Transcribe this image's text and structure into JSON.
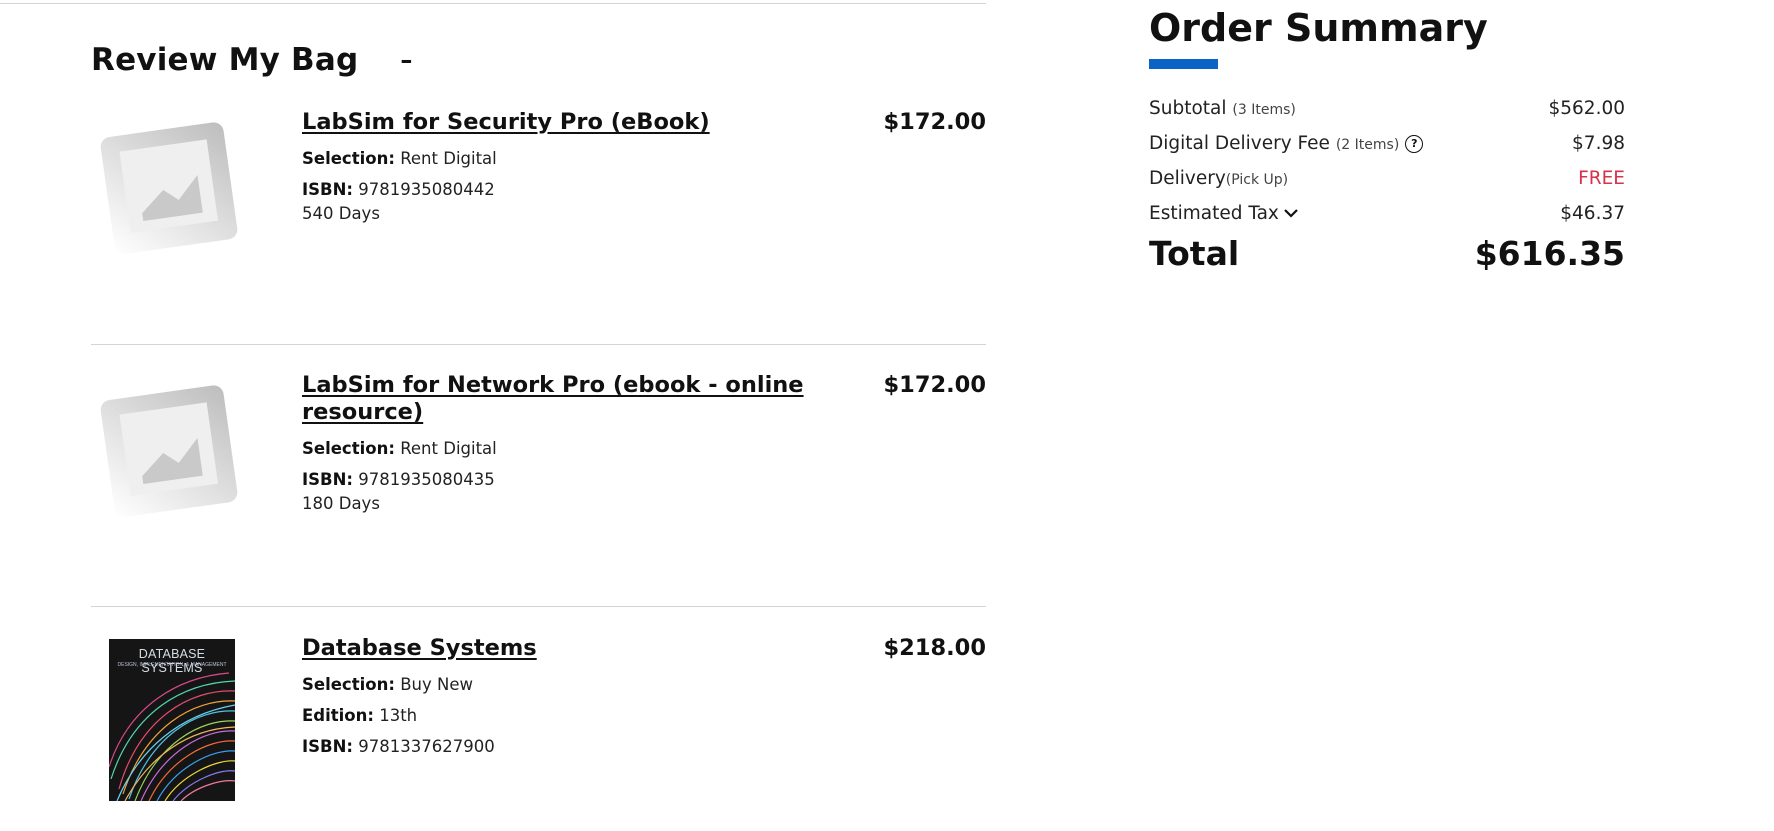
{
  "bag": {
    "title": "Review My Bag",
    "collapse_symbol": "–",
    "items": [
      {
        "title": "LabSim for Security Pro (eBook)",
        "price": "$172.00",
        "image": "placeholder-image",
        "attrs": [
          {
            "label": "Selection:",
            "value": "Rent Digital"
          },
          {
            "label": "ISBN:",
            "value": "9781935080442"
          }
        ],
        "note": "540 Days"
      },
      {
        "title": "LabSim for Network Pro (ebook - online resource)",
        "price": "$172.00",
        "image": "placeholder-image",
        "attrs": [
          {
            "label": "Selection:",
            "value": "Rent Digital"
          },
          {
            "label": "ISBN:",
            "value": "9781935080435"
          }
        ],
        "note": "180 Days"
      },
      {
        "title": "Database Systems",
        "price": "$218.00",
        "image": "book-cover",
        "cover_title": "DATABASE SYSTEMS",
        "cover_subtitle": "DESIGN, IMPLEMENTATION, & MANAGEMENT",
        "attrs": [
          {
            "label": "Selection:",
            "value": "Buy New"
          },
          {
            "label": "Edition:",
            "value": "13th"
          },
          {
            "label": "ISBN:",
            "value": "9781337627900"
          }
        ],
        "note": ""
      }
    ]
  },
  "summary": {
    "title": "Order Summary",
    "accent_color": "#0a64c8",
    "subtotal": {
      "label": "Subtotal",
      "detail": "(3 Items)",
      "value": "$562.00"
    },
    "digital_fee": {
      "label": "Digital Delivery Fee",
      "detail": "(2 Items)",
      "value": "$7.98",
      "icon": "help-icon"
    },
    "delivery": {
      "label": "Delivery",
      "detail": "(Pick Up)",
      "value": "FREE",
      "value_color": "#d6324a"
    },
    "tax": {
      "label": "Estimated Tax",
      "value": "$46.37",
      "icon": "chevron-down-icon"
    },
    "total": {
      "label": "Total",
      "value": "$616.35"
    }
  }
}
